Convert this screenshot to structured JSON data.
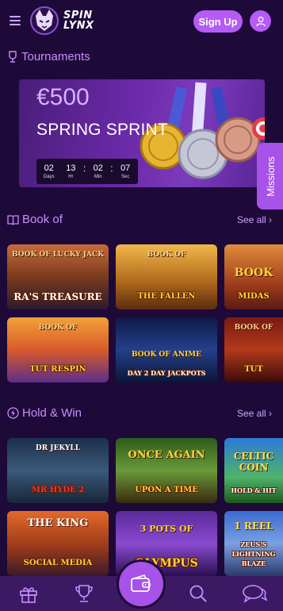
{
  "header": {
    "logo_line1": "SPIN",
    "logo_line2": "LYNX",
    "signup_label": "Sign Up"
  },
  "tournaments": {
    "title": "Tournaments",
    "banner": {
      "amount": "€500",
      "name": "SPRING SPRINT",
      "countdown": [
        {
          "value": "02",
          "unit": "Days"
        },
        {
          "value": "13",
          "unit": "Hr"
        },
        {
          "value": "02",
          "unit": "Min"
        },
        {
          "value": "07",
          "unit": "Sec"
        }
      ]
    }
  },
  "missions_label": "Missions",
  "book_of": {
    "title": "Book of",
    "see_all": "See all",
    "games": [
      {
        "sub": "BOOK OF LUCKY JACK",
        "title": "RA'S TREASURE"
      },
      {
        "sub": "BOOK OF",
        "title": "THE FALLEN"
      },
      {
        "sub": "BOOK",
        "title": "MIDAS"
      },
      {
        "sub": "BOOK OF",
        "title": "TUT RESPIN"
      },
      {
        "sub": "BOOK OF ANIME",
        "title": "DAY 2 DAY JACKPOTS"
      },
      {
        "sub": "BOOK OF",
        "title": "TUT"
      }
    ]
  },
  "hold_win": {
    "title": "Hold & Win",
    "see_all": "See all",
    "games": [
      {
        "sub": "DR JEKYLL",
        "title": "MR HYDE 2"
      },
      {
        "sub": "ONCE AGAIN",
        "title": "UPON A TIME"
      },
      {
        "sub": "CELTIC COIN",
        "title": "HOLD & HIT"
      },
      {
        "sub": "THE KING",
        "title": "SOCIAL MEDIA"
      },
      {
        "sub": "3 POTS OF",
        "title": "OLYMPUS"
      },
      {
        "sub": "1 REEL",
        "title": "ZEUS'S LIGHTNING BLAZE"
      }
    ]
  }
}
